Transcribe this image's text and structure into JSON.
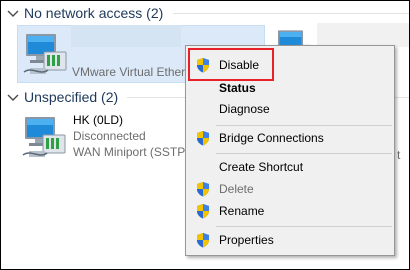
{
  "groups": [
    {
      "title": "No network access (2)"
    },
    {
      "title": "Unspecified (2)"
    }
  ],
  "adapters": [
    {
      "device": "VMware Virtual Ether"
    },
    {
      "name": "HK (0LD)",
      "status": "Disconnected",
      "device": "WAN Miniport (SSTP)"
    }
  ],
  "partial_text": "t",
  "icons": {
    "collapse": "chevron-down-icon",
    "adapter": "network-adapter-icon",
    "uac": "uac-shield-icon"
  },
  "context_menu": {
    "items": [
      {
        "label": "Disable",
        "icon": "uac-shield-icon",
        "bold": false,
        "disabled": false
      },
      {
        "label": "Status",
        "bold": true,
        "disabled": false
      },
      {
        "label": "Diagnose",
        "bold": false,
        "disabled": false
      },
      {
        "label": "Bridge Connections",
        "icon": "uac-shield-icon",
        "bold": false,
        "disabled": false
      },
      {
        "label": "Create Shortcut",
        "bold": false,
        "disabled": false
      },
      {
        "label": "Delete",
        "icon": "uac-shield-icon",
        "bold": false,
        "disabled": true
      },
      {
        "label": "Rename",
        "icon": "uac-shield-icon",
        "bold": false,
        "disabled": false
      },
      {
        "label": "Properties",
        "icon": "uac-shield-icon",
        "bold": false,
        "disabled": false
      }
    ]
  },
  "colors": {
    "group_header": "#1e395b",
    "selection": "#dbe9f8",
    "menu_background": "#f0f0f0",
    "highlight": "#e8202a",
    "uac_blue": "#2a6ad0",
    "uac_yellow": "#f3c300"
  }
}
